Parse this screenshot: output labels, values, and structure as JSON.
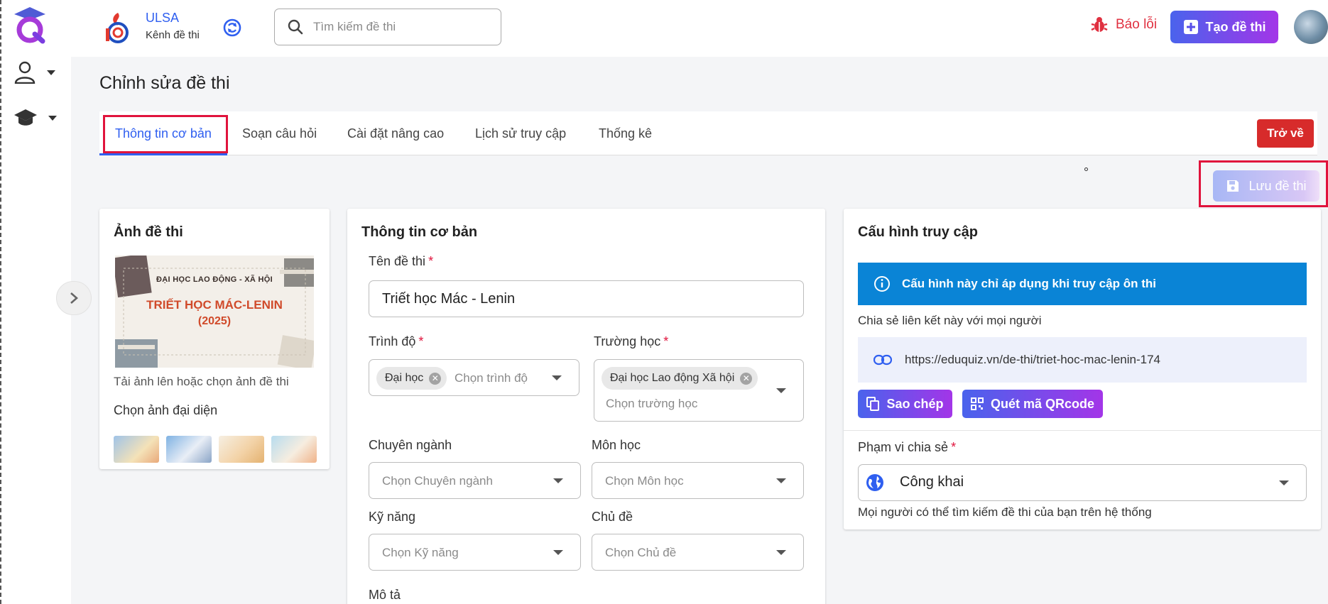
{
  "header": {
    "brand_name": "ULSA",
    "brand_sub": "Kênh đề thi",
    "search_placeholder": "Tìm kiếm đề thi",
    "report_label": "Báo lỗi",
    "create_label": "Tạo đề thi"
  },
  "page": {
    "title": "Chỉnh sửa đề thi",
    "tabs": [
      {
        "label": "Thông tin cơ bản",
        "active": true
      },
      {
        "label": "Soạn câu hỏi"
      },
      {
        "label": "Cài đặt nâng cao"
      },
      {
        "label": "Lịch sử truy cập"
      },
      {
        "label": "Thống kê"
      }
    ],
    "back_label": "Trở về",
    "save_label": "Lưu đề thi"
  },
  "cover_card": {
    "title": "Ảnh đề thi",
    "cover_text": {
      "line1": "ĐẠI HỌC LAO ĐỘNG - XÃ HỘI",
      "line2": "TRIẾT HỌC MÁC-LENIN",
      "line3": "(2025)"
    },
    "upload_hint": "Tải ảnh lên hoặc chọn ảnh đề thi",
    "choose_label": "Chọn ảnh đại diện"
  },
  "basic_card": {
    "title": "Thông tin cơ bản",
    "name_label": "Tên đề thi",
    "name_value": "Triết học Mác - Lenin",
    "level_label": "Trình độ",
    "level_chip": "Đại học",
    "level_placeholder": "Chọn trình độ",
    "school_label": "Trường học",
    "school_chip": "Đại học Lao động Xã hội",
    "school_placeholder": "Chọn trường học",
    "major_label": "Chuyên ngành",
    "major_placeholder": "Chọn Chuyên ngành",
    "subject_label": "Môn học",
    "subject_placeholder": "Chọn Môn học",
    "skill_label": "Kỹ năng",
    "skill_placeholder": "Chọn Kỹ năng",
    "topic_label": "Chủ đề",
    "topic_placeholder": "Chọn Chủ đề",
    "desc_label": "Mô tả"
  },
  "access_card": {
    "title": "Cấu hình truy cập",
    "info_text": "Cấu hình này chỉ áp dụng khi truy cập ôn thi",
    "share_text": "Chia sẻ liên kết này với mọi người",
    "link": "https://eduquiz.vn/de-thi/triet-hoc-mac-lenin-174",
    "copy_label": "Sao chép",
    "qr_label": "Quét mã QRcode",
    "scope_label": "Phạm vi chia sẻ",
    "scope_value": "Công khai",
    "scope_hint": "Mọi người có thể tìm kiếm đề thi của bạn trên hệ thống"
  },
  "colors": {
    "primary": "#2f5ff0",
    "danger": "#d72b2b",
    "highlight": "#e0133c",
    "info": "#0a84d6"
  }
}
